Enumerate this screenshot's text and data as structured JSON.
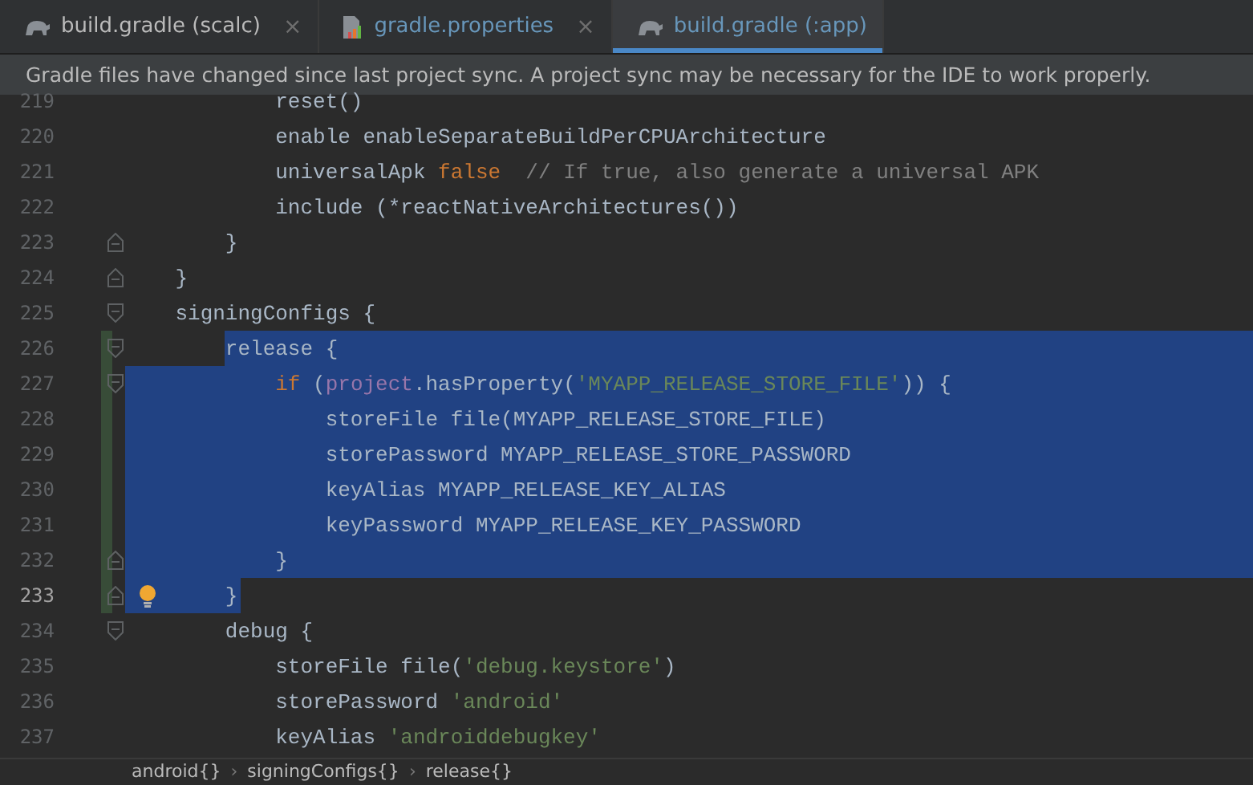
{
  "tabs": [
    {
      "label": "build.gradle (scalc)",
      "kind": "gradle",
      "modified": false,
      "selected": false,
      "close": "×"
    },
    {
      "label": "gradle.properties",
      "kind": "properties",
      "modified": true,
      "selected": false,
      "close": "×"
    },
    {
      "label": "build.gradle (:app)",
      "kind": "gradle",
      "modified": true,
      "selected": true
    }
  ],
  "banner": {
    "text": "Gradle files have changed since last project sync. A project sync may be necessary for the IDE to work properly."
  },
  "editor": {
    "lines": [
      {
        "number": "219",
        "selected": false,
        "changed": false,
        "fold_start": false,
        "fold_end": false,
        "segments": [
          {
            "kind": "plain",
            "text": "            reset()"
          }
        ]
      },
      {
        "number": "220",
        "selected": false,
        "changed": false,
        "fold_start": false,
        "fold_end": false,
        "segments": [
          {
            "kind": "plain",
            "text": "            enable enableSeparateBuildPerCPUArchitecture"
          }
        ]
      },
      {
        "number": "221",
        "selected": false,
        "changed": false,
        "fold_start": false,
        "fold_end": false,
        "segments": [
          {
            "kind": "plain",
            "text": "            universalApk "
          },
          {
            "kind": "keyword",
            "text": "false"
          },
          {
            "kind": "comment",
            "text": "  // If true, also generate a universal APK"
          }
        ]
      },
      {
        "number": "222",
        "selected": false,
        "changed": false,
        "fold_start": false,
        "fold_end": false,
        "segments": [
          {
            "kind": "plain",
            "text": "            include (*reactNativeArchitectures())"
          }
        ]
      },
      {
        "number": "223",
        "selected": false,
        "changed": false,
        "fold_start": false,
        "fold_end": true,
        "segments": [
          {
            "kind": "plain",
            "text": "        }"
          }
        ]
      },
      {
        "number": "224",
        "selected": false,
        "changed": false,
        "fold_start": false,
        "fold_end": true,
        "segments": [
          {
            "kind": "plain",
            "text": "    }"
          }
        ]
      },
      {
        "number": "225",
        "selected": false,
        "changed": false,
        "fold_start": true,
        "fold_end": false,
        "segments": [
          {
            "kind": "plain",
            "text": "    signingConfigs {"
          }
        ]
      },
      {
        "number": "226",
        "selected": true,
        "changed": true,
        "fold_start": true,
        "fold_end": false,
        "segments": [
          {
            "kind": "plain",
            "text": "        release {"
          }
        ]
      },
      {
        "number": "227",
        "selected": true,
        "changed": true,
        "fold_start": true,
        "fold_end": false,
        "segments": [
          {
            "kind": "keyword",
            "text": "            if"
          },
          {
            "kind": "plain",
            "text": " ("
          },
          {
            "kind": "field",
            "text": "project"
          },
          {
            "kind": "plain",
            "text": ".hasProperty("
          },
          {
            "kind": "string",
            "text": "'MYAPP_RELEASE_STORE_FILE'"
          },
          {
            "kind": "plain",
            "text": ")) {"
          }
        ]
      },
      {
        "number": "228",
        "selected": true,
        "changed": true,
        "fold_start": false,
        "fold_end": false,
        "segments": [
          {
            "kind": "plain",
            "text": "                storeFile file(MYAPP_RELEASE_STORE_FILE)"
          }
        ]
      },
      {
        "number": "229",
        "selected": true,
        "changed": true,
        "fold_start": false,
        "fold_end": false,
        "segments": [
          {
            "kind": "plain",
            "text": "                storePassword MYAPP_RELEASE_STORE_PASSWORD"
          }
        ]
      },
      {
        "number": "230",
        "selected": true,
        "changed": true,
        "fold_start": false,
        "fold_end": false,
        "segments": [
          {
            "kind": "plain",
            "text": "                keyAlias MYAPP_RELEASE_KEY_ALIAS"
          }
        ]
      },
      {
        "number": "231",
        "selected": true,
        "changed": true,
        "fold_start": false,
        "fold_end": false,
        "segments": [
          {
            "kind": "plain",
            "text": "                keyPassword MYAPP_RELEASE_KEY_PASSWORD"
          }
        ]
      },
      {
        "number": "232",
        "selected": true,
        "changed": true,
        "fold_start": false,
        "fold_end": true,
        "segments": [
          {
            "kind": "plain",
            "text": "            }"
          }
        ]
      },
      {
        "number": "233",
        "selected": true,
        "changed": true,
        "fold_start": false,
        "fold_end": true,
        "current": true,
        "bulb": true,
        "segments": [
          {
            "kind": "plain",
            "text": "        }"
          }
        ]
      },
      {
        "number": "234",
        "selected": false,
        "changed": false,
        "fold_start": true,
        "fold_end": false,
        "segments": [
          {
            "kind": "plain",
            "text": "        debug {"
          }
        ]
      },
      {
        "number": "235",
        "selected": false,
        "changed": false,
        "fold_start": false,
        "fold_end": false,
        "segments": [
          {
            "kind": "plain",
            "text": "            storeFile file("
          },
          {
            "kind": "string",
            "text": "'debug.keystore'"
          },
          {
            "kind": "plain",
            "text": ")"
          }
        ]
      },
      {
        "number": "236",
        "selected": false,
        "changed": false,
        "fold_start": false,
        "fold_end": false,
        "segments": [
          {
            "kind": "plain",
            "text": "            storePassword "
          },
          {
            "kind": "string",
            "text": "'android'"
          }
        ]
      },
      {
        "number": "237",
        "selected": false,
        "changed": false,
        "fold_start": false,
        "fold_end": false,
        "segments": [
          {
            "kind": "plain",
            "text": "            keyAlias "
          },
          {
            "kind": "string",
            "text": "'androiddebugkey'"
          }
        ]
      }
    ]
  },
  "breadcrumbs": {
    "separator": "›",
    "items": [
      "android{}",
      "signingConfigs{}",
      "release{}"
    ]
  }
}
